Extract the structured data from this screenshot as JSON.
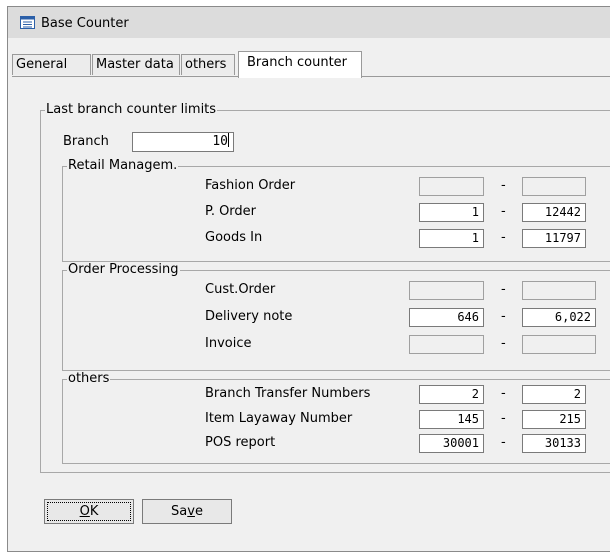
{
  "window": {
    "title": "Base Counter"
  },
  "tabs": [
    {
      "label": "General"
    },
    {
      "label": "Master data"
    },
    {
      "label": "others"
    },
    {
      "label": "Branch counter",
      "active": true
    }
  ],
  "main": {
    "group_title": "Last branch counter limits",
    "branch_label": "Branch",
    "branch_value": "10",
    "sections": [
      {
        "title": "Retail Managem.",
        "rows": [
          {
            "label": "Fashion Order",
            "from": "",
            "to": ""
          },
          {
            "label": "P. Order",
            "from": "1",
            "to": "12442"
          },
          {
            "label": "Goods In",
            "from": "1",
            "to": "11797"
          }
        ]
      },
      {
        "title": "Order Processing",
        "rows": [
          {
            "label": "Cust.Order",
            "from": "",
            "to": ""
          },
          {
            "label": "Delivery note",
            "from": "646",
            "to": "6,022"
          },
          {
            "label": "Invoice",
            "from": "",
            "to": ""
          }
        ]
      },
      {
        "title": "others",
        "rows": [
          {
            "label": "Branch Transfer Numbers",
            "from": "2",
            "to": "2"
          },
          {
            "label": "Item Layaway Number",
            "from": "145",
            "to": "215"
          },
          {
            "label": "POS report",
            "from": "30001",
            "to": "30133"
          }
        ]
      }
    ],
    "dash": "-"
  },
  "buttons": {
    "ok_mnemonic": "O",
    "ok_rest": "K",
    "save_prefix": "Sa",
    "save_mnemonic": "v",
    "save_rest": "e"
  },
  "colors": {
    "window_bg": "#f0f0f0",
    "titlebar_bg": "#dcdcdc",
    "icon_blue": "#2b5fa8"
  }
}
